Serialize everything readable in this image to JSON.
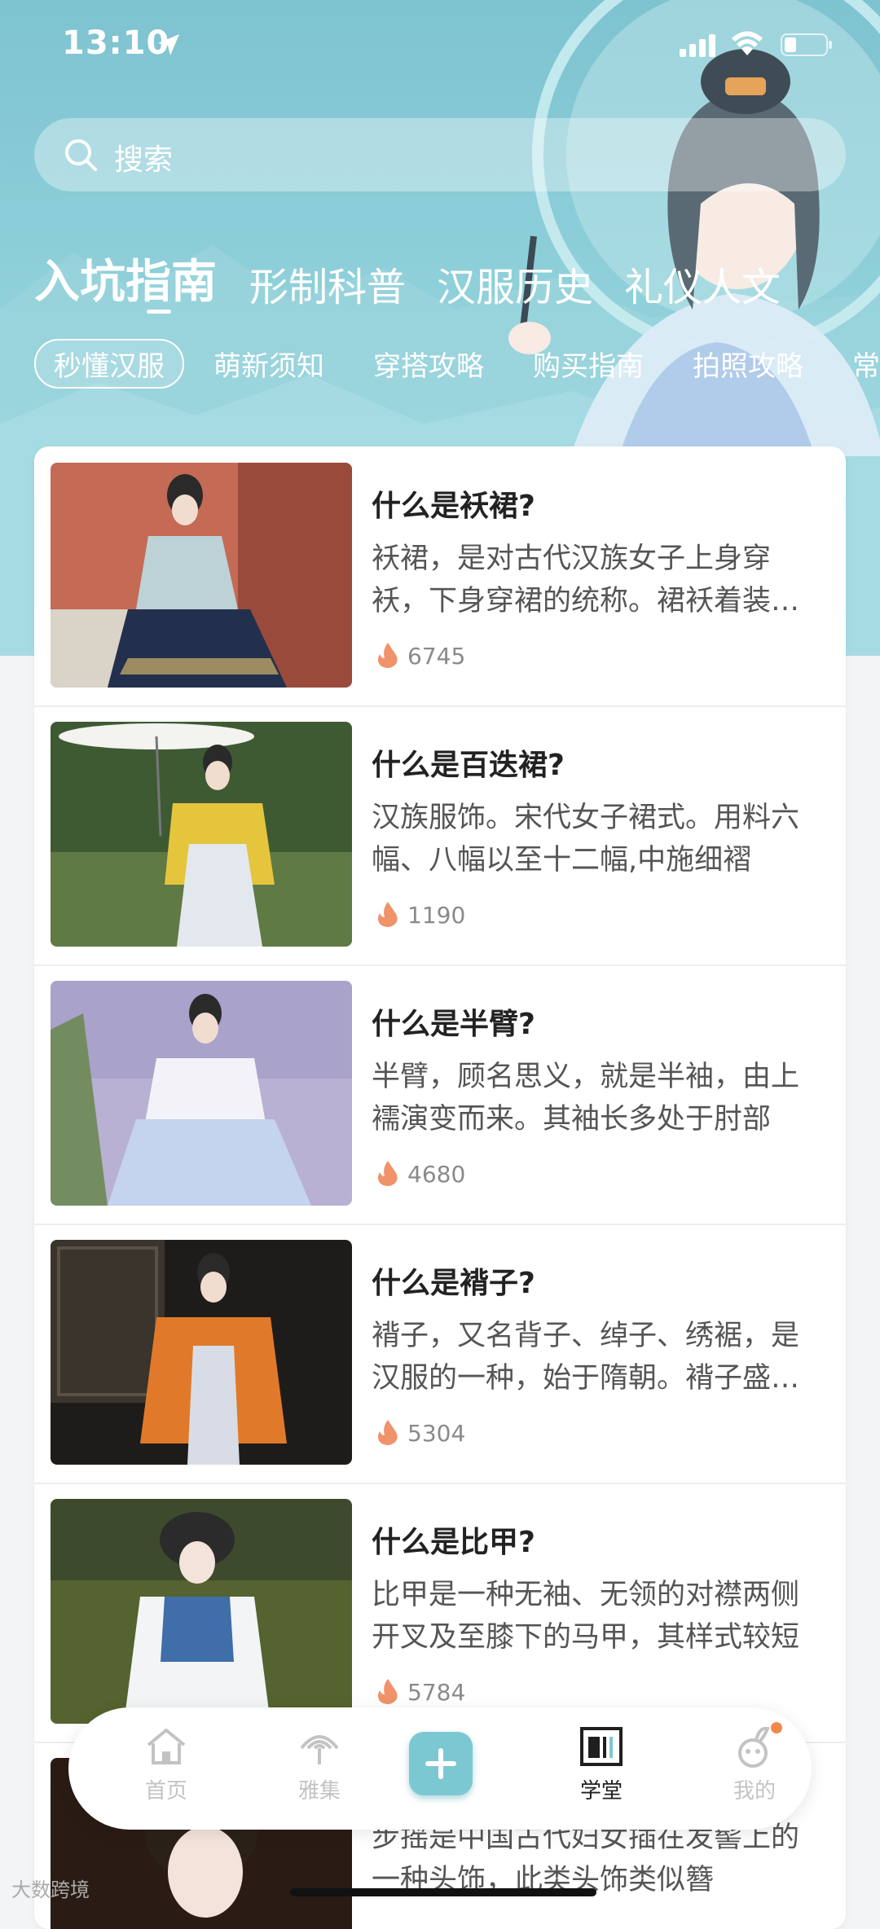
{
  "status_bar": {
    "time": "13:10"
  },
  "search": {
    "placeholder": "搜索"
  },
  "tabs": [
    {
      "label": "入坑指南",
      "active": true
    },
    {
      "label": "形制科普",
      "active": false
    },
    {
      "label": "汉服历史",
      "active": false
    },
    {
      "label": "礼仪人文",
      "active": false
    }
  ],
  "subtabs": [
    {
      "label": "秒懂汉服",
      "active": true
    },
    {
      "label": "萌新须知",
      "active": false
    },
    {
      "label": "穿搭攻略",
      "active": false
    },
    {
      "label": "购买指南",
      "active": false
    },
    {
      "label": "拍照攻略",
      "active": false
    },
    {
      "label": "常",
      "active": false
    }
  ],
  "articles": [
    {
      "title": "什么是袄裙?",
      "desc": "袄裙，是对古代汉族女子上身穿袄，下身穿裙的统称。裙袄着装是明代女子的主要服饰",
      "count": "6745"
    },
    {
      "title": "什么是百迭裙?",
      "desc": "汉族服饰。宋代女子裙式。用料六幅、八幅以至十二幅,中施细褶",
      "count": "1190"
    },
    {
      "title": "什么是半臂?",
      "desc": "半臂，顾名思义，就是半袖，由上襦演变而来。其袖长多处于肘部",
      "count": "4680"
    },
    {
      "title": "什么是褙子?",
      "desc": "褙子，又名背子、绰子、绣裾，是汉服的一种，始于隋朝。褙子盛行于宋代",
      "count": "5304"
    },
    {
      "title": "什么是比甲?",
      "desc": "比甲是一种无袖、无领的对襟两侧开叉及至膝下的马甲，其样式较短",
      "count": "5784"
    },
    {
      "title": "",
      "desc": "步摇是中国古代妇女插在发髻上的一种头饰，此类头饰类似簪",
      "count": ""
    }
  ],
  "nav": {
    "home": "首页",
    "collection": "雅集",
    "school": "学堂",
    "mine": "我的"
  },
  "watermark": "大数跨境",
  "colors": {
    "accent": "#7cc8d2",
    "hero_bg": "#8fd0da",
    "flame": "#f0926a",
    "badge": "#f08a4b"
  }
}
